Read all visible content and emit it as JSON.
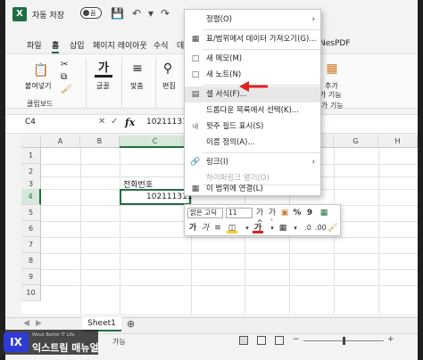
{
  "titlebar": {
    "autosave_label": "자동 저장",
    "toggle_state": "끔"
  },
  "menu_tabs": [
    "파일",
    "홈",
    "삽입",
    "페이지 레이아웃",
    "수식",
    "데"
  ],
  "menu_tab_right": "NesPDF",
  "ribbon": {
    "paste": "붙여넣기",
    "clipboard": "클립보드",
    "font": "글꼴",
    "align": "맞춤",
    "edit": "편집",
    "add_in_1": "추가",
    "add_in_2": "가 기능",
    "add_in_group": "가 기능"
  },
  "formula_bar": {
    "name_box": "C4",
    "fx": "fx",
    "value": "102111311"
  },
  "grid": {
    "columns": [
      "A",
      "B",
      "C",
      "D",
      "E",
      "F",
      "G",
      "H"
    ],
    "rows": [
      "1",
      "2",
      "3",
      "4",
      "5",
      "6",
      "7",
      "8",
      "9",
      "10"
    ],
    "c3": "전화번호",
    "c4": "102111311"
  },
  "context_menu": {
    "items": [
      {
        "label": "정렬(O)",
        "icon": "sort-icon",
        "submenu": true,
        "enabled": true
      },
      {
        "label": "표/범위에서 데이터 가져오기(G)...",
        "icon": "table-icon",
        "enabled": true
      },
      {
        "label": "새 메모(M)",
        "icon": "comment-icon",
        "enabled": true
      },
      {
        "label": "새 노트(N)",
        "icon": "note-icon",
        "enabled": true
      },
      {
        "label": "셀 서식(F)...",
        "icon": "format-cells-icon",
        "enabled": true
      },
      {
        "label": "드롭다운 목록에서 선택(K)...",
        "icon": "",
        "enabled": true
      },
      {
        "label": "윗주 필드 표시(S)",
        "icon": "phonetic-icon",
        "enabled": true
      },
      {
        "label": "이름 정의(A)...",
        "icon": "",
        "enabled": true
      },
      {
        "label": "링크(I)",
        "icon": "link-icon",
        "submenu": true,
        "enabled": true
      },
      {
        "label": "하이퍼링크 열기(O)",
        "icon": "",
        "enabled": false
      },
      {
        "label": "이 범위에 연결(L)",
        "icon": "range-link-icon",
        "enabled": true
      }
    ]
  },
  "mini_toolbar": {
    "font": "맑은 고딕",
    "size": "11",
    "grow": "가^",
    "shrink": "가`",
    "percent": "%",
    "comma": "9",
    "bold": "가",
    "italic": "가"
  },
  "sheet": {
    "tab": "Sheet1",
    "status": "가능"
  },
  "watermark": {
    "badge": "IX",
    "subtitle": "Wave Better IT Life",
    "name": "익스트림 매뉴얼"
  },
  "colors": {
    "excel_green": "#1d6f42",
    "arrow_red": "#e0201d",
    "badge_blue": "#2f3bd6"
  }
}
